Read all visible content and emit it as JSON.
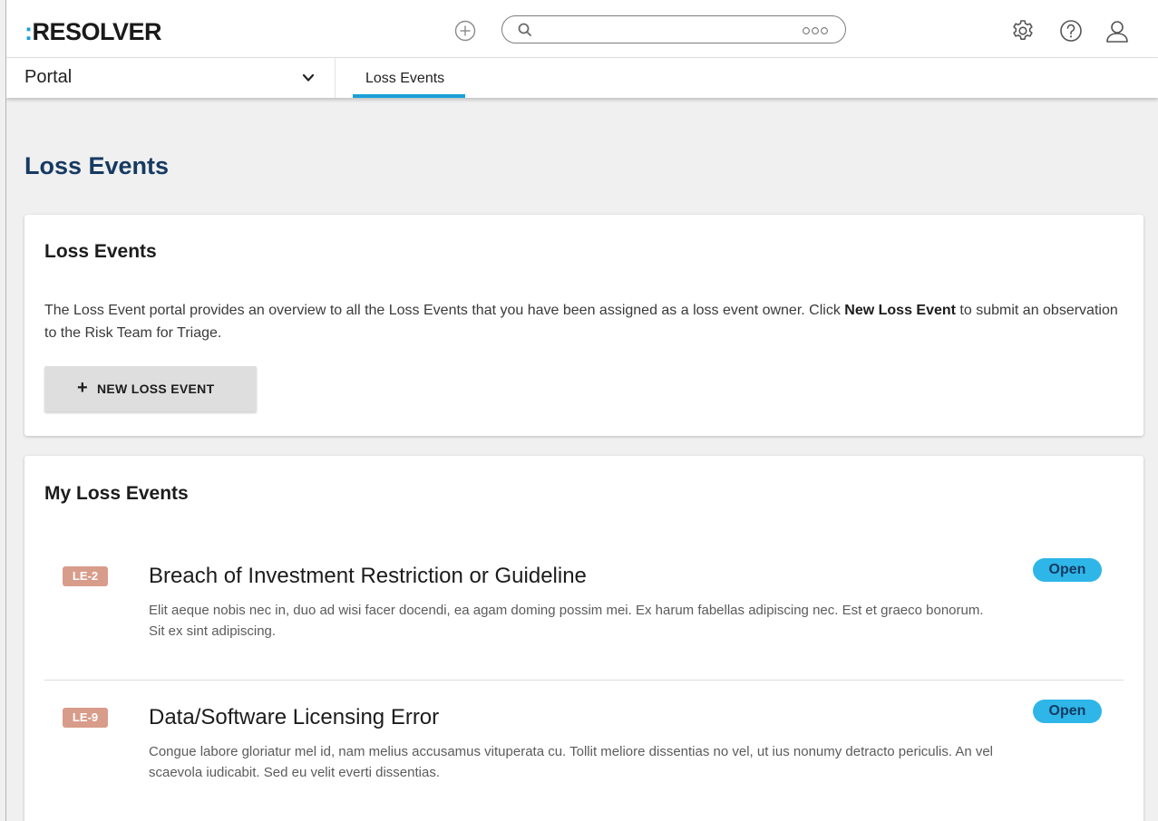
{
  "brand": {
    "prefix": ":",
    "name": "RESOLVER"
  },
  "search": {
    "placeholder": ""
  },
  "nav": {
    "portal_label": "Portal",
    "active_tab": "Loss Events"
  },
  "page": {
    "title": "Loss Events"
  },
  "intro_card": {
    "title": "Loss Events",
    "description_before": "The Loss Event portal provides an overview to all the Loss Events that you have been assigned as a loss event owner. Click ",
    "description_bold": "New Loss Event",
    "description_after": " to submit an observation to the Risk Team for Triage.",
    "button_icon": "+",
    "button_label": "NEW LOSS EVENT"
  },
  "my_events": {
    "title": "My Loss Events",
    "items": [
      {
        "id": "LE-2",
        "title": "Breach of Investment Restriction or Guideline",
        "description": "Elit aeque nobis nec in, duo ad wisi facer docendi, ea agam doming possim mei. Ex harum fabellas adipiscing nec. Est et graeco bonorum. Sit ex sint adipiscing.",
        "status": "Open"
      },
      {
        "id": "LE-9",
        "title": "Data/Software Licensing Error",
        "description": "Congue labore gloriatur mel id, nam melius accusamus vituperata cu. Tollit meliore dissentias no vel, ut ius nonumy detracto periculis. An vel scaevola iudicabit. Sed eu velit everti dissentias.",
        "status": "Open"
      }
    ]
  },
  "colors": {
    "accent": "#1aa0d8",
    "title_navy": "#163a62",
    "id_badge": "#d89c8a",
    "status_badge": "#2eb6e8"
  },
  "icons": [
    "add-circle-icon",
    "search-icon",
    "more-icon",
    "gear-icon",
    "help-icon",
    "user-icon",
    "chevron-down-icon"
  ]
}
